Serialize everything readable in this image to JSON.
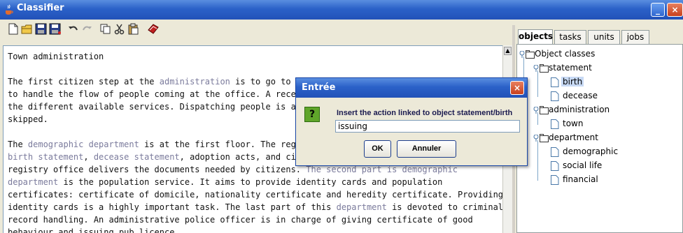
{
  "window": {
    "title": "Classifier",
    "min_label": "_",
    "close_label": "×"
  },
  "toolbar": {
    "icons": [
      "new-icon",
      "open-icon",
      "save-icon",
      "save-as-icon",
      "undo-icon",
      "redo-icon",
      "copy-icon",
      "cut-icon",
      "paste-icon",
      "classify-icon"
    ]
  },
  "document": {
    "lines": [
      [
        {
          "t": "Town administration"
        }
      ],
      [
        {
          "t": ""
        }
      ],
      [
        {
          "t": "The first citizen step at the "
        },
        {
          "t": "administration",
          "k": 1
        },
        {
          "t": " is to go to the"
        }
      ],
      [
        {
          "t": "to handle the flow of people coming at the office. A recept"
        }
      ],
      [
        {
          "t": "the different available services. Dispatching people is an i"
        }
      ],
      [
        {
          "t": "skipped."
        }
      ],
      [
        {
          "t": ""
        }
      ],
      [
        {
          "t": "The "
        },
        {
          "t": "demographic department",
          "k": 1
        },
        {
          "t": " is at the first floor. The regist"
        }
      ],
      [
        {
          "t": "birth statement",
          "k": 1
        },
        {
          "t": ", "
        },
        {
          "t": "decease statement",
          "k": 1
        },
        {
          "t": ", adoption acts, and civil"
        }
      ],
      [
        {
          "t": "registry office delivers the documents needed by citizens. "
        },
        {
          "t": "The second part is demographic",
          "k": 1
        }
      ],
      [
        {
          "t": "department",
          "k": 1
        },
        {
          "t": " is the population service. It aims to provide identity cards and population"
        }
      ],
      [
        {
          "t": "certificates: certificate of domicile, nationality certificate and heredity certificate. Providing"
        }
      ],
      [
        {
          "t": "identity cards is a highly important task. The last part of this "
        },
        {
          "t": "department",
          "k": 1
        },
        {
          "t": " is devoted to criminal"
        }
      ],
      [
        {
          "t": "record handling. An administrative police officer is in charge of giving certificate of good"
        }
      ],
      [
        {
          "t": "behaviour and issuing pub licence."
        }
      ]
    ]
  },
  "tabs": [
    {
      "label": "objects",
      "active": true
    },
    {
      "label": "tasks",
      "active": false
    },
    {
      "label": "units",
      "active": false
    },
    {
      "label": "jobs",
      "active": false
    }
  ],
  "tree": {
    "root": "Object classes",
    "statement": "statement",
    "birth": "birth",
    "decease": "decease",
    "administration": "administration",
    "town": "town",
    "department": "department",
    "demographic": "demographic",
    "social_life": "social life",
    "financial": "financial"
  },
  "dialog": {
    "title": "Entrée",
    "close_label": "×",
    "message": "Insert the action linked to object statement/birth",
    "input_value": "issuing",
    "ok_label": "OK",
    "cancel_label": "Annuler",
    "icon_glyph": "?"
  },
  "colors": {
    "titlebar": "#2b61c8",
    "keyword": "#7b7b9c",
    "selection": "#c7d9f4",
    "question_icon": "#5fa52a"
  }
}
